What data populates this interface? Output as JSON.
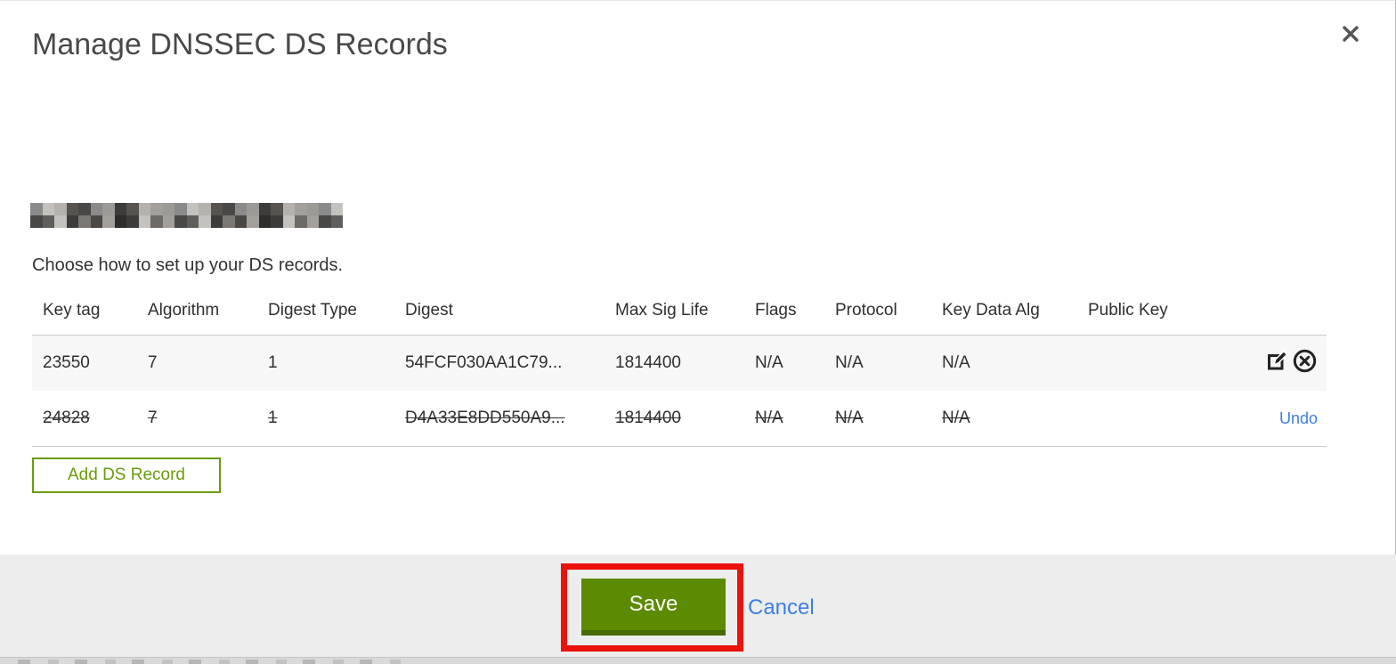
{
  "dialog": {
    "title": "Manage DNSSEC DS Records",
    "instruction": "Choose how to set up your DS records.",
    "domain": {
      "redacted": true,
      "redaction_palette": [
        "#8a8a8a",
        "#5f5e5c",
        "#3d3c3a",
        "#b5b2ae",
        "#6e6a66",
        "#4a4846",
        "#9c9a96",
        "#2e2d2b",
        "#c4c2be",
        "#57544f",
        "#7b7874",
        "#a39f9a"
      ]
    }
  },
  "table": {
    "headers": [
      "Key tag",
      "Algorithm",
      "Digest Type",
      "Digest",
      "Max Sig Life",
      "Flags",
      "Protocol",
      "Key Data Alg",
      "Public Key"
    ],
    "rows": [
      {
        "state": "active",
        "cells": [
          "23550",
          "7",
          "1",
          "54FCF030AA1C79...",
          "1814400",
          "N/A",
          "N/A",
          "N/A",
          ""
        ],
        "actions": [
          "edit",
          "delete"
        ]
      },
      {
        "state": "deleted",
        "cells": [
          "24828",
          "7",
          "1",
          "D4A33E8DD550A9...",
          "1814400",
          "N/A",
          "N/A",
          "N/A",
          ""
        ],
        "undo_label": "Undo"
      }
    ]
  },
  "buttons": {
    "add_ds_record": "Add DS Record",
    "save": "Save",
    "cancel": "Cancel"
  },
  "colors": {
    "green": "#699b0c",
    "save_bg": "#5c8a00",
    "link_blue": "#3c7fe1",
    "annotation_red": "#ea120c",
    "footer_bg": "#ededed"
  }
}
